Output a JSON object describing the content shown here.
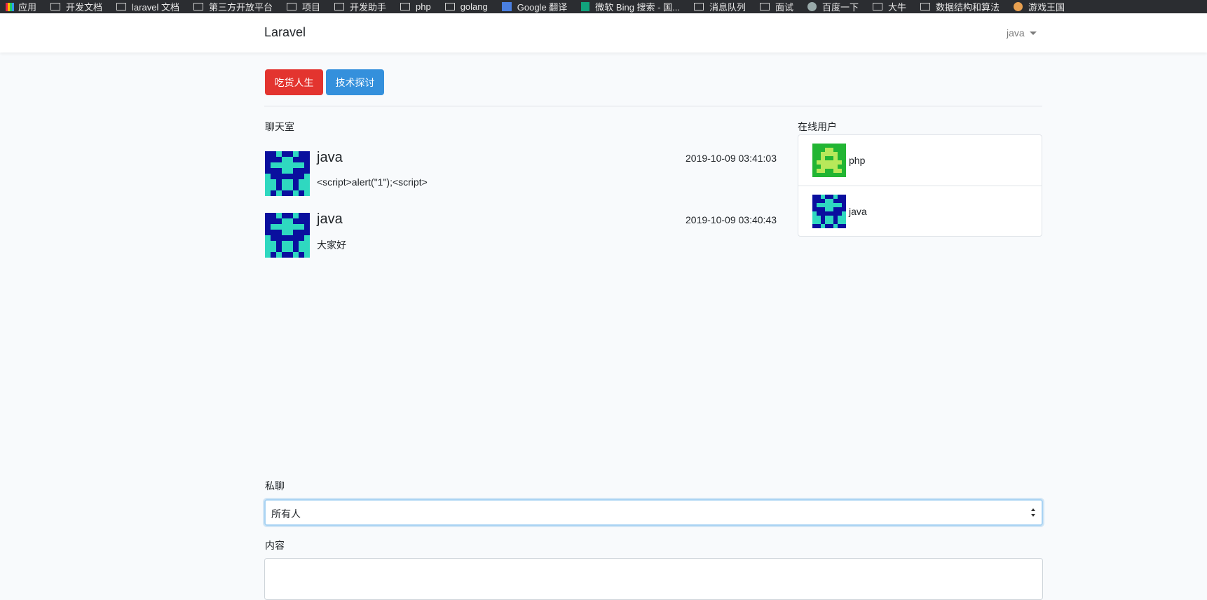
{
  "bookmarks": [
    {
      "label": "应用",
      "icon": "apps-grid-icon"
    },
    {
      "label": "开发文档",
      "icon": "folder-icon"
    },
    {
      "label": "laravel 文档",
      "icon": "folder-icon"
    },
    {
      "label": "第三方开放平台",
      "icon": "folder-icon"
    },
    {
      "label": "项目",
      "icon": "folder-icon"
    },
    {
      "label": "开发助手",
      "icon": "folder-icon"
    },
    {
      "label": "php",
      "icon": "folder-icon"
    },
    {
      "label": "golang",
      "icon": "folder-icon"
    },
    {
      "label": "Google 翻译",
      "icon": "google-translate-icon"
    },
    {
      "label": "微软 Bing 搜索 - 国...",
      "icon": "bing-icon"
    },
    {
      "label": "消息队列",
      "icon": "folder-icon"
    },
    {
      "label": "面试",
      "icon": "folder-icon"
    },
    {
      "label": "百度一下",
      "icon": "globe-icon"
    },
    {
      "label": "大牛",
      "icon": "folder-icon"
    },
    {
      "label": "数据结构和算法",
      "icon": "folder-icon"
    },
    {
      "label": "游戏王国",
      "icon": "game-icon"
    }
  ],
  "navbar": {
    "brand": "Laravel",
    "user": "java"
  },
  "rooms": {
    "food_label": "吃货人生",
    "tech_label": "技术探讨",
    "food_color": "#e3342f",
    "tech_color": "#3490dc"
  },
  "chat": {
    "title": "聊天室",
    "messages": [
      {
        "user": "java",
        "time": "2019-10-09 03:41:03",
        "text": "<script>alert(\"1\");<script>"
      },
      {
        "user": "java",
        "time": "2019-10-09 03:40:43",
        "text": "大家好"
      }
    ]
  },
  "online": {
    "title": "在线用户",
    "users": [
      {
        "name": "php"
      },
      {
        "name": "java"
      }
    ]
  },
  "form": {
    "private_label": "私聊",
    "private_value": "所有人",
    "content_label": "内容"
  }
}
